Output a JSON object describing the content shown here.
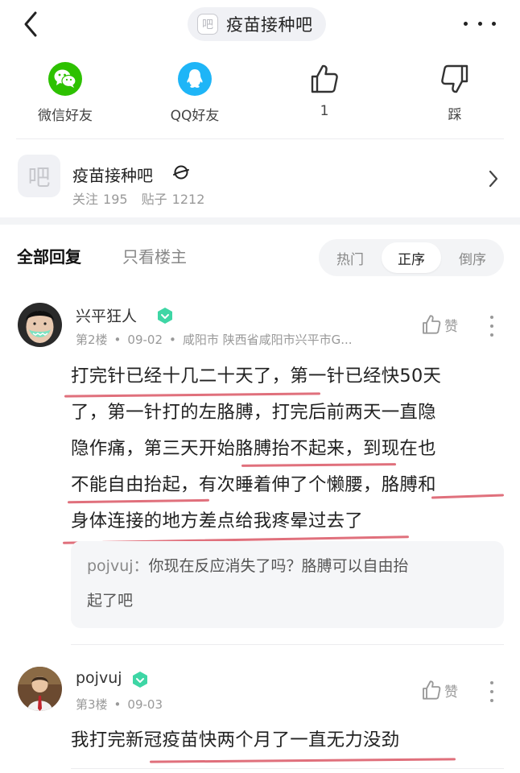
{
  "topbar": {
    "back_icon": "chevron-left-icon",
    "title_icon_char": "吧",
    "title": "疫苗接种吧",
    "more_icon": "more-horizontal-icon"
  },
  "share": {
    "wechat_label": "微信好友",
    "wechat_color": "#2dc100",
    "qq_label": "QQ好友",
    "qq_color": "#1eb5f7",
    "like_count": "1",
    "dislike_label": "踩"
  },
  "forum": {
    "logo_char": "吧",
    "name": "疫苗接种吧",
    "follow_label": "关注",
    "follow_count": "195",
    "posts_label": "贴子",
    "posts_count": "1212"
  },
  "filter": {
    "all_label": "全部回复",
    "host_label": "只看楼主",
    "sort_hot": "热门",
    "sort_asc": "正序",
    "sort_desc": "倒序",
    "active": "正序"
  },
  "replies": [
    {
      "user": "兴平狂人",
      "floor": "第2楼",
      "date": "09-02",
      "location": "咸阳市  陕西省咸阳市兴平市G...",
      "like_label": "赞",
      "lines": [
        "打完针已经十几二十天了，第一针已经快50天",
        "了，第一针打的左胳膊，打完后前两天一直隐",
        "隐作痛，第三天开始胳膊抬不起来，到现在也",
        "不能自由抬起，有次睡着伸了个懒腰，胳膊和",
        "身体连接的地方差点给我疼晕过去了"
      ],
      "sub_user": "pojvuj：",
      "sub_text_1": "你现在反应消失了吗？胳膊可以自由抬",
      "sub_text_2": "起了吧"
    },
    {
      "user": "pojvuj",
      "floor": "第3楼",
      "date": "09-03",
      "like_label": "赞",
      "lines": [
        "我打完新冠疫苗快两个月了一直无力没劲"
      ]
    }
  ],
  "colors": {
    "accent_underline": "#e0707c",
    "badge_green": "#3ed6a5"
  }
}
